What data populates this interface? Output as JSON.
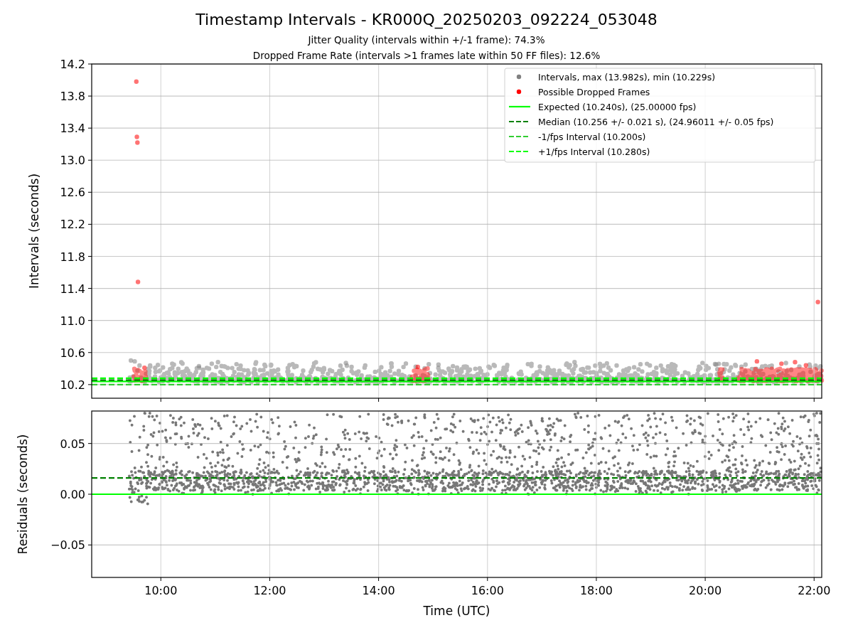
{
  "title": "Timestamp Intervals - KR000Q_20250203_092224_053048",
  "subtitles": [
    "Jitter Quality (intervals within +/-1 frame): 74.3%",
    "Dropped Frame Rate (intervals >1 frames late within 50 FF files): 12.6%"
  ],
  "charts": [
    {
      "chart_data": {
        "type": "scatter",
        "ylabel": "Intervals (seconds)",
        "xlim": [
          8.73,
          22.14
        ],
        "ylim": [
          10.03,
          14.2
        ],
        "grid": true,
        "legend": true,
        "yticks": [
          {
            "value": 10.2,
            "label": "10.2"
          },
          {
            "value": 10.6,
            "label": "10.6"
          },
          {
            "value": 11.0,
            "label": "11.0"
          },
          {
            "value": 11.4,
            "label": "11.4"
          },
          {
            "value": 11.8,
            "label": "11.8"
          },
          {
            "value": 12.2,
            "label": "12.2"
          },
          {
            "value": 12.6,
            "label": "12.6"
          },
          {
            "value": 13.0,
            "label": "13.0"
          },
          {
            "value": 13.4,
            "label": "13.4"
          },
          {
            "value": 13.8,
            "label": "13.8"
          },
          {
            "value": 14.2,
            "label": "14.2"
          }
        ],
        "x": [
          9.45,
          9.52,
          10.7,
          11.05,
          13.4,
          15.1,
          17.6,
          19.95,
          20.2,
          9.55,
          9.56,
          9.57,
          9.58,
          22.07,
          9.7,
          14.72,
          20.95,
          21.4,
          21.65,
          21.85
        ],
        "series": [
          {
            "name": "Intervals, max (13.982s), min (10.229s)",
            "color": "#808080",
            "values": [
              10.5,
              10.49,
              10.43,
              10.48,
              10.47,
              10.45,
              10.48,
              10.47,
              10.45,
              null,
              null,
              null,
              null,
              null,
              null,
              null,
              null,
              null,
              null,
              null
            ]
          },
          {
            "name": "Possible Dropped Frames",
            "color": "#ff0000",
            "values": [
              null,
              null,
              null,
              null,
              null,
              null,
              null,
              null,
              null,
              13.98,
              13.29,
              13.22,
              11.48,
              11.23,
              10.41,
              10.42,
              10.49,
              10.46,
              10.48,
              10.44
            ]
          }
        ],
        "ref_lines": [
          {
            "axis": "y",
            "label": "Expected (10.240s), (25.00000 fps)",
            "color": "#00ff00",
            "value": 10.24
          },
          {
            "axis": "y",
            "label": "Median (10.256 +/- 0.021 s), (24.96011 +/- 0.05 fps)",
            "color": "#008000",
            "value": 10.256
          },
          {
            "axis": "y",
            "label": "-1/fps Interval (10.200s)",
            "color": "#32cd32",
            "value": 10.2
          },
          {
            "axis": "y",
            "label": "+1/fps Interval (10.280s)",
            "color": "#00ff00",
            "value": 10.28
          }
        ]
      }
    },
    {
      "chart_data": {
        "type": "scatter",
        "xlabel": "Time (UTC)",
        "ylabel": "Residuals (seconds)",
        "xlim": [
          8.73,
          22.14
        ],
        "ylim": [
          -0.082,
          0.082
        ],
        "grid": true,
        "xticks": [
          {
            "value": 10,
            "label": "10:00"
          },
          {
            "value": 12,
            "label": "12:00"
          },
          {
            "value": 14,
            "label": "14:00"
          },
          {
            "value": 16,
            "label": "16:00"
          },
          {
            "value": 18,
            "label": "18:00"
          },
          {
            "value": 20,
            "label": "20:00"
          },
          {
            "value": 22,
            "label": "22:00"
          }
        ],
        "yticks": [
          {
            "value": -0.05,
            "label": "−0.05"
          },
          {
            "value": 0,
            "label": "0.00"
          },
          {
            "value": 0.05,
            "label": "0.05"
          }
        ],
        "ref_lines": [
          {
            "axis": "y",
            "color": "#00ff00",
            "value": 0
          },
          {
            "axis": "y",
            "color": "#008000",
            "value": 0.016
          }
        ]
      }
    }
  ]
}
